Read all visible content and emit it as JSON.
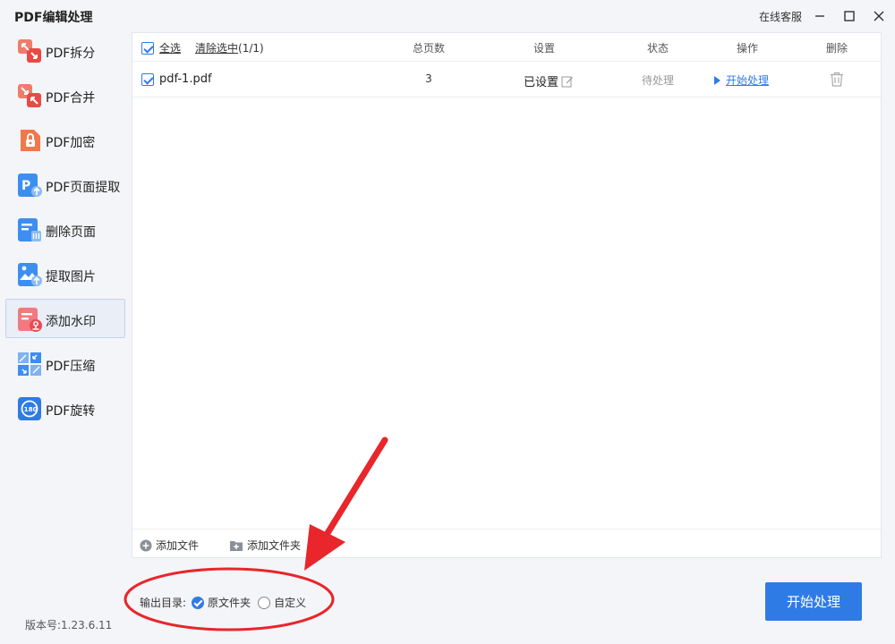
{
  "window": {
    "title": "PDF编辑处理",
    "support_link": "在线客服"
  },
  "sidebar": {
    "items": [
      {
        "label": "PDF拆分",
        "icon": "split-icon"
      },
      {
        "label": "PDF合并",
        "icon": "merge-icon"
      },
      {
        "label": "PDF加密",
        "icon": "lock-icon"
      },
      {
        "label": "PDF页面提取",
        "icon": "page-extract-icon"
      },
      {
        "label": "删除页面",
        "icon": "delete-page-icon"
      },
      {
        "label": "提取图片",
        "icon": "image-extract-icon"
      },
      {
        "label": "添加水印",
        "icon": "watermark-icon",
        "active": true
      },
      {
        "label": "PDF压缩",
        "icon": "compress-icon"
      },
      {
        "label": "PDF旋转",
        "icon": "rotate-icon"
      }
    ],
    "version": "版本号:1.23.6.11"
  },
  "table": {
    "select_all": "全选",
    "clear_selection": "清除选中",
    "selection_count": "(1/1)",
    "headers": {
      "pages": "总页数",
      "settings": "设置",
      "status": "状态",
      "action": "操作",
      "delete": "删除"
    },
    "rows": [
      {
        "file_name": "pdf-1.pdf",
        "pages": "3",
        "setting": "已设置",
        "status": "待处理",
        "action": "开始处理"
      }
    ],
    "add_file": "添加文件",
    "add_folder": "添加文件夹"
  },
  "output": {
    "label": "输出目录:",
    "options": [
      "原文件夹",
      "自定义"
    ],
    "selected": "原文件夹"
  },
  "start_button": "开始处理",
  "colors": {
    "accent": "#2f7be6",
    "annotation": "#e8262b"
  }
}
